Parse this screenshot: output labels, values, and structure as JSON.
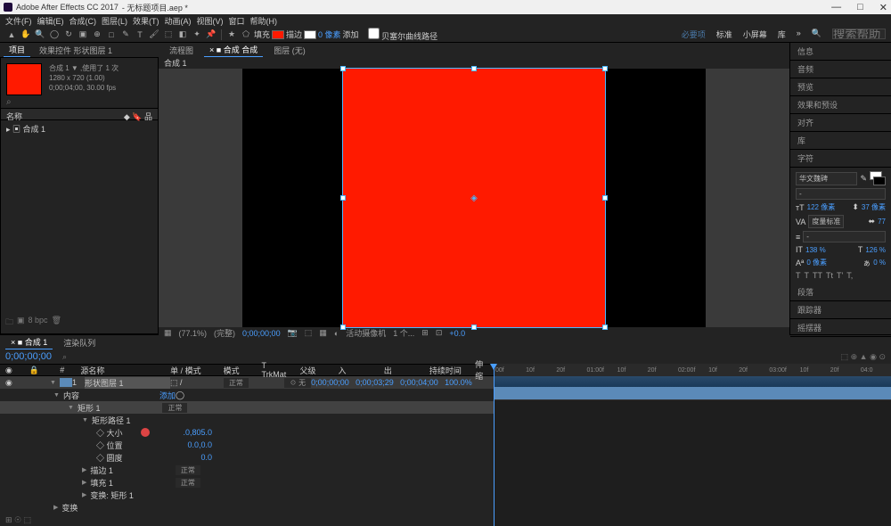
{
  "titlebar": {
    "app": "Adobe After Effects CC 2017",
    "project": "无标题项目.aep *"
  },
  "menu": {
    "file": "文件(F)",
    "edit": "编辑(E)",
    "comp": "合成(C)",
    "layer": "图层(L)",
    "effect": "效果(T)",
    "anim": "动画(A)",
    "view": "视图(V)",
    "window": "窗口",
    "help": "帮助(H)"
  },
  "toolbar": {
    "fill_label": "填充",
    "stroke_label": "描边",
    "stroke_width": "0 像素",
    "add_label": "添加",
    "bezier_label": "贝塞尔曲线路径",
    "right_tabs": {
      "essential": "必要项",
      "standard": "标准",
      "small": "小屏幕",
      "lib": "库"
    },
    "search_ph": "搜索帮助"
  },
  "project": {
    "tab_project": "项目",
    "tab_effects": "效果控件 形状图层 1",
    "name": "合成 1",
    "used": "1",
    "res": "1280 x 720 (1.00)",
    "dur": "0;00;04;00, 30.00 fps",
    "col_name": "名称",
    "item_comp": "合成 1",
    "bpc": "8 bpc"
  },
  "viewer": {
    "tab_flowchart": "流程图",
    "tab_comp": "合成 合成",
    "tab_layer": "图层 (无)",
    "crumb": "合成 1",
    "zoom": "(77.1%)",
    "res": "(完整)",
    "camera": "活动摄像机",
    "view": "1 个...",
    "exposure": "+0.0",
    "time": "0;00;00;00"
  },
  "right_panels": {
    "info": "信息",
    "audio": "音频",
    "preview": "预览",
    "effects": "效果和预设",
    "align": "对齐",
    "libs": "库",
    "char": "字符",
    "para": "段落",
    "tracker": "跟踪器",
    "wiggle": "摇摆器"
  },
  "char": {
    "font": "华文魏碑",
    "size": "122 像素",
    "leading": "37 像素",
    "kerning": "度量标准",
    "tracking": "77",
    "vscale": "138 %",
    "hscale": "126 %",
    "baseline": "0 像素",
    "tsume": "0 %",
    "styles": [
      "T",
      "T",
      "TT",
      "Tt",
      "T'",
      "T,"
    ]
  },
  "timeline": {
    "tab_comp": "合成 1",
    "tab_render": "渲染队列",
    "timecode": "0;00;00;00",
    "cols": {
      "src": "源名称",
      "switches": "单 / 模式",
      "mode": "模式",
      "trkmat": "T TrkMat",
      "parent": "父级",
      "in": "入",
      "out": "出",
      "duration": "持续时间",
      "stretch": "伸缩"
    },
    "layer1": {
      "name": "形状图层 1",
      "mode": "正常",
      "parent": "无",
      "in": "0;00;00;00",
      "out": "0;00;03;29",
      "dur": "0;00;04;00",
      "stretch": "100.0%"
    },
    "props": {
      "contents": "内容",
      "add": "添加",
      "rect1": "矩形 1",
      "rect_mode": "正常",
      "rect_path": "矩形路径 1",
      "size": "大小",
      "size_val": ".0,805.0",
      "pos": "位置",
      "pos_val": "0.0,0.0",
      "round": "圆度",
      "round_val": "0.0",
      "stroke": "描边 1",
      "stroke_mode": "正常",
      "fill": "填充 1",
      "fill_mode": "正常",
      "xform": "变换: 矩形 1",
      "xform2": "变换"
    },
    "ruler": [
      "00f",
      "10f",
      "20f",
      "01:00f",
      "10f",
      "20f",
      "02:00f",
      "10f",
      "20f",
      "03:00f",
      "10f",
      "20f",
      "04:0"
    ]
  }
}
